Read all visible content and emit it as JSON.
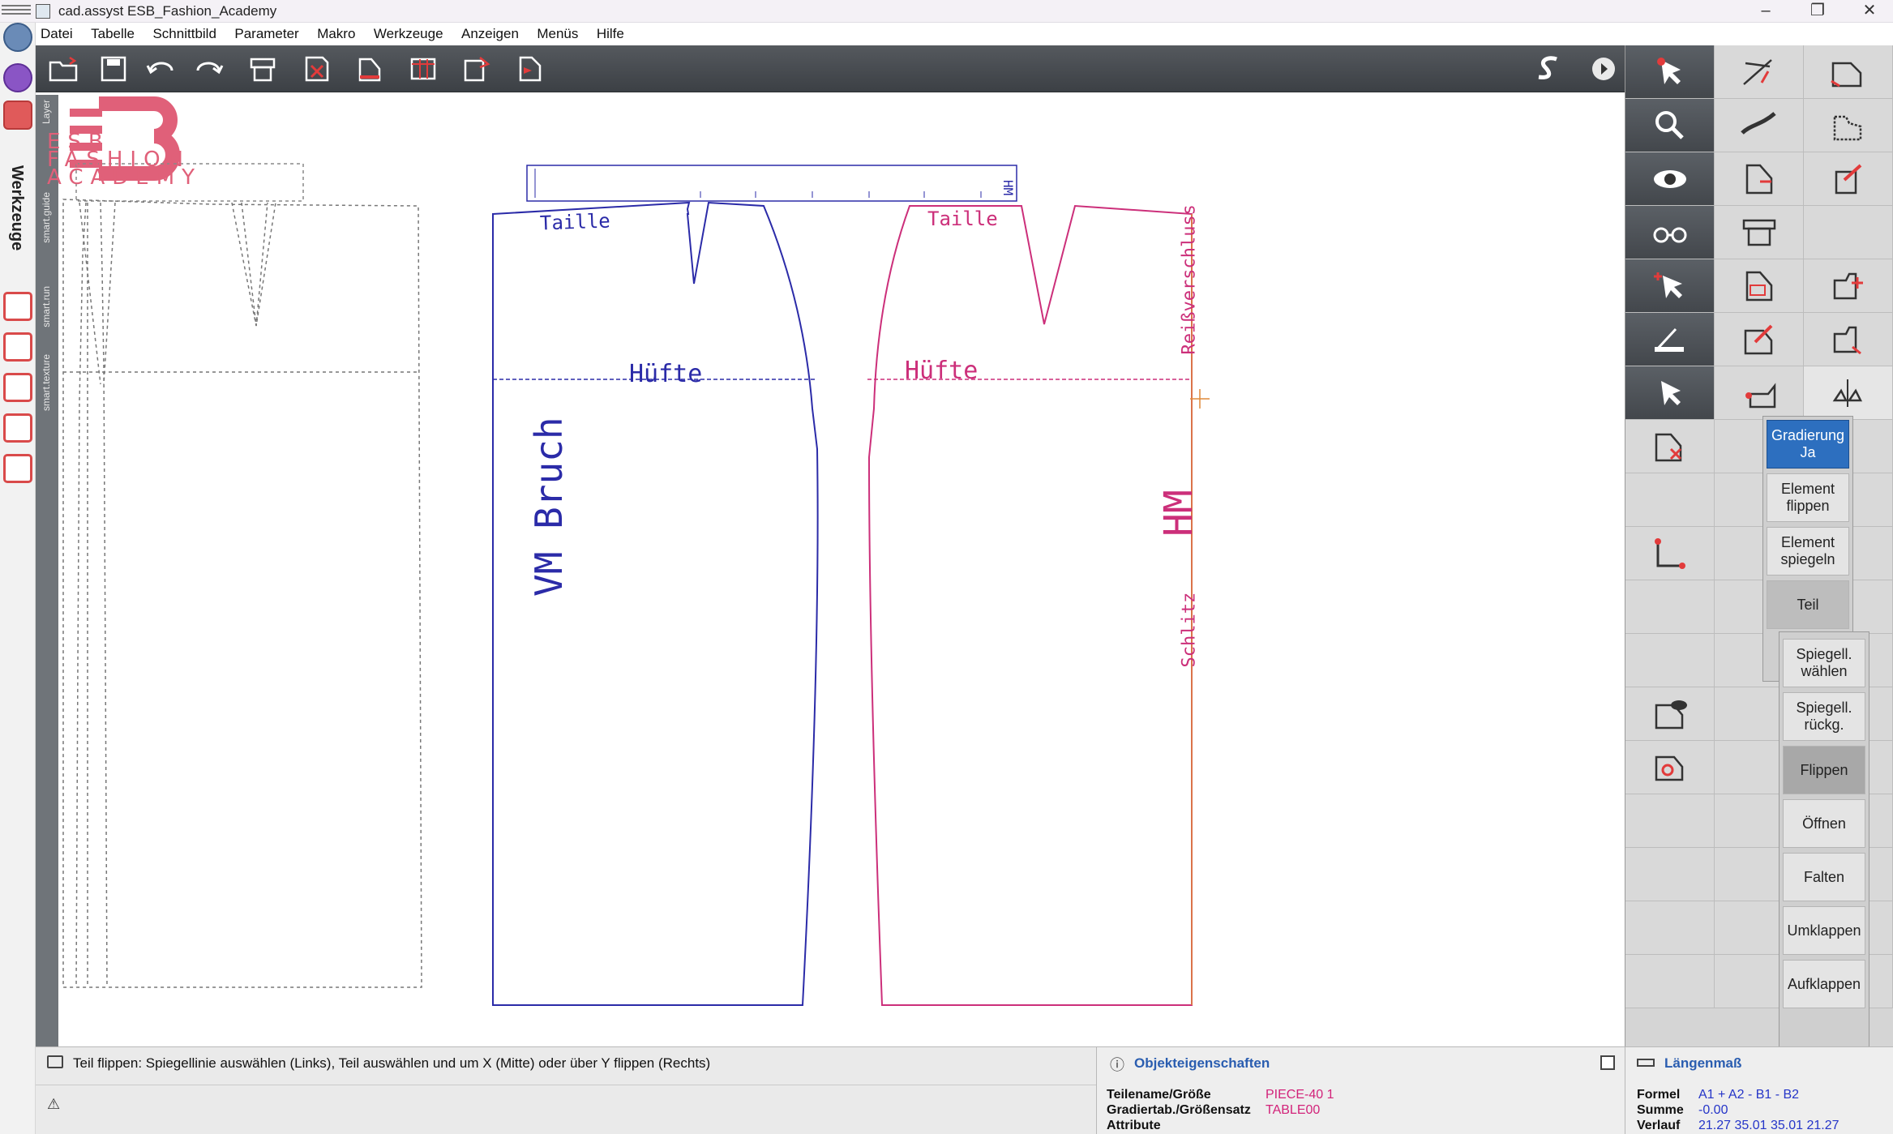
{
  "window": {
    "title": "cad.assyst  ESB_Fashion_Academy"
  },
  "menu": [
    "Datei",
    "Tabelle",
    "Schnittbild",
    "Parameter",
    "Makro",
    "Werkzeuge",
    "Anzeigen",
    "Menüs",
    "Hilfe"
  ],
  "left_panel": {
    "label": "Werkzeuge",
    "tabs": [
      "Layer",
      "smart.guide",
      "smart.run",
      "smart.texture"
    ]
  },
  "logo": {
    "line1": "ESB",
    "line2": "FASHION",
    "line3": "ACADEMY"
  },
  "canvas": {
    "label_block_text": "HM",
    "front": {
      "waist": "Taille",
      "hip": "Hüfte",
      "fold": "VM Bruch"
    },
    "back": {
      "waist": "Taille",
      "hip": "Hüfte",
      "zip": "Reißverschluss",
      "center": "HM",
      "slit": "Schlitz"
    },
    "colors": {
      "front": "#2b2ba8",
      "back": "#cc2f7a",
      "ghost": "#777777"
    }
  },
  "flyout_main": [
    {
      "label": "Gradierung Ja",
      "state": "selected"
    },
    {
      "label": "Element flippen",
      "state": "normal"
    },
    {
      "label": "Element spiegeln",
      "state": "normal"
    },
    {
      "label": "Teil",
      "state": "active"
    }
  ],
  "flyout_sub": [
    {
      "label": "Spiegell. wählen",
      "state": "normal"
    },
    {
      "label": "Spiegell. rückg.",
      "state": "normal"
    },
    {
      "label": "Flippen",
      "state": "active"
    },
    {
      "label": "Öffnen",
      "state": "normal"
    },
    {
      "label": "Falten",
      "state": "normal"
    },
    {
      "label": "Umklappen",
      "state": "normal"
    },
    {
      "label": "Aufklappen",
      "state": "normal"
    }
  ],
  "status": {
    "message": "Teil flippen: Spiegellinie auswählen (Links), Teil auswählen und um X (Mitte) oder über Y flippen (Rechts)",
    "warn_icon": "warning-icon"
  },
  "properties": {
    "title": "Objekteigenschaften",
    "rows": [
      {
        "key": "Teilename/Größe",
        "value": "PIECE-40 1"
      },
      {
        "key": "Gradiertab./Größensatz",
        "value": "TABLE00"
      },
      {
        "key": "Attribute",
        "value": ""
      }
    ]
  },
  "measure": {
    "title": "Längenmaß",
    "rows": [
      {
        "key": "Formel",
        "value": "A1 + A2 - B1 - B2"
      },
      {
        "key": "Summe",
        "value": "-0.00"
      },
      {
        "key": "Verlauf",
        "value": "21.27 35.01 35.01 21.27"
      }
    ]
  }
}
